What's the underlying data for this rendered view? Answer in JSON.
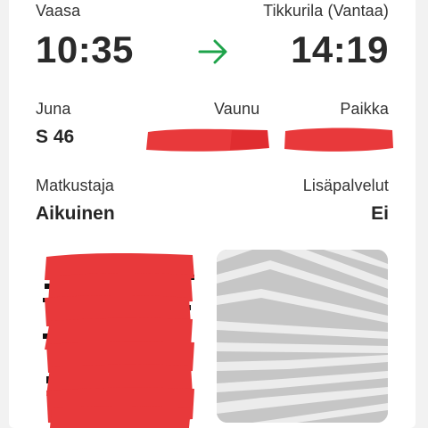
{
  "route": {
    "from_station": "Vaasa",
    "to_station": "Tikkurila (Vantaa)",
    "departure_time": "10:35",
    "arrival_time": "14:19",
    "arrow_icon": "arrow-right-icon",
    "accent_color": "#1ea34a"
  },
  "train": {
    "train_label": "Juna",
    "train_value": "S 46",
    "car_label": "Vaunu",
    "seat_label": "Paikka"
  },
  "passenger": {
    "passenger_label": "Matkustaja",
    "passenger_value": "Aikuinen",
    "extras_label": "Lisäpalvelut",
    "extras_value": "Ei"
  },
  "redaction_color": "#e8393b"
}
